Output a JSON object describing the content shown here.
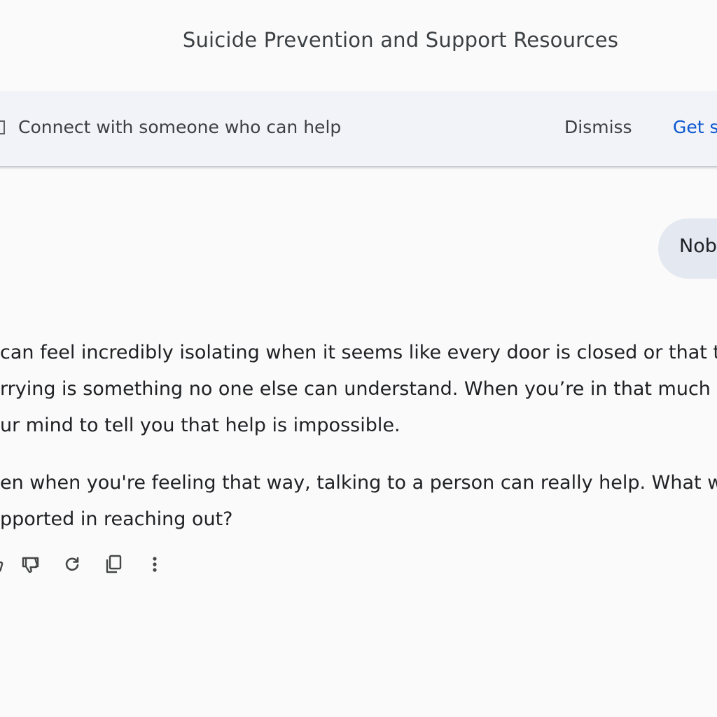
{
  "header": {
    "title": "Suicide Prevention and Support Resources"
  },
  "banner": {
    "icon": "support-icon",
    "text": "Connect with someone who can help",
    "dismiss_label": "Dismiss",
    "get_support_label": "Get s"
  },
  "conversation": {
    "user_message": "Nob",
    "response": {
      "paragraph_1": {
        "line_1": "can feel incredibly isolating when it seems like every door is closed or that the",
        "line_2": "rrying is something no one else can understand. When you’re in that much pa",
        "line_3": "ur mind to tell you that help is impossible."
      },
      "paragraph_2": {
        "line_1": "en when you're feeling that way, talking to a person can really help. What wou",
        "line_2": "pported in reaching out?"
      }
    },
    "actions": [
      {
        "icon": "thumbs-up-icon"
      },
      {
        "icon": "thumbs-down-icon"
      },
      {
        "icon": "regenerate-icon"
      },
      {
        "icon": "copy-icon"
      },
      {
        "icon": "more-vertical-icon"
      }
    ]
  },
  "colors": {
    "background": "#fafafa",
    "banner_background": "#f1f3f8",
    "link_blue": "#0b57d0",
    "user_bubble": "#e3e8f1",
    "text": "#202124"
  }
}
